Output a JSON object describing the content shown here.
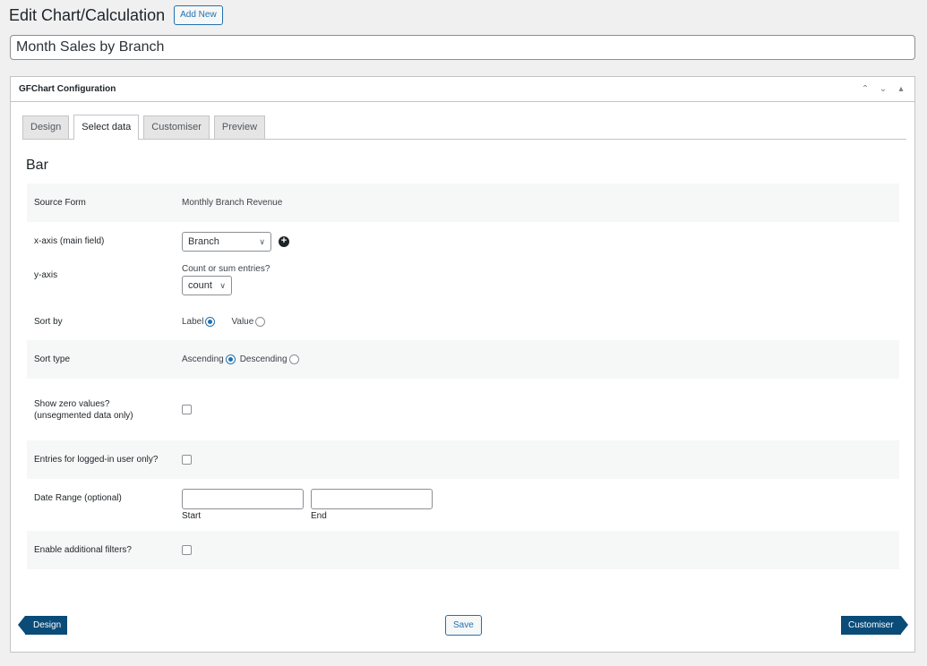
{
  "header": {
    "title": "Edit Chart/Calculation",
    "add_new_label": "Add New"
  },
  "post_title": "Month Sales by Branch",
  "postbox": {
    "title": "GFChart Configuration",
    "icons": [
      "chevron-up-icon",
      "chevron-down-icon",
      "toggle-panel-icon"
    ]
  },
  "tabs": [
    {
      "label": "Design",
      "active": false
    },
    {
      "label": "Select data",
      "active": true
    },
    {
      "label": "Customiser",
      "active": false
    },
    {
      "label": "Preview",
      "active": false
    }
  ],
  "chart_type": "Bar",
  "rows": {
    "source_form": {
      "label": "Source Form",
      "value": "Monthly Branch Revenue"
    },
    "x_axis": {
      "label": "x-axis (main field)",
      "selected": "Branch"
    },
    "y_axis": {
      "label": "y-axis",
      "prompt": "Count or sum entries?",
      "selected": "count"
    },
    "sort_by": {
      "label": "Sort by",
      "options": [
        {
          "label": "Label",
          "checked": true
        },
        {
          "label": "Value",
          "checked": false
        }
      ]
    },
    "sort_type": {
      "label": "Sort type",
      "options": [
        {
          "label": "Ascending",
          "checked": true
        },
        {
          "label": "Descending",
          "checked": false
        }
      ]
    },
    "show_zero": {
      "label": "Show zero values? (unsegmented data only)",
      "checked": false
    },
    "logged_in": {
      "label": "Entries for logged-in user only?",
      "checked": false
    },
    "date_range": {
      "label": "Date Range (optional)",
      "start_label": "Start",
      "end_label": "End",
      "start_value": "",
      "end_value": ""
    },
    "filters": {
      "label": "Enable additional filters?",
      "checked": false
    }
  },
  "footer": {
    "prev_label": "Design",
    "save_label": "Save",
    "next_label": "Customiser"
  },
  "colors": {
    "accent": "#2271b1",
    "nav_button": "#0a4b78"
  }
}
